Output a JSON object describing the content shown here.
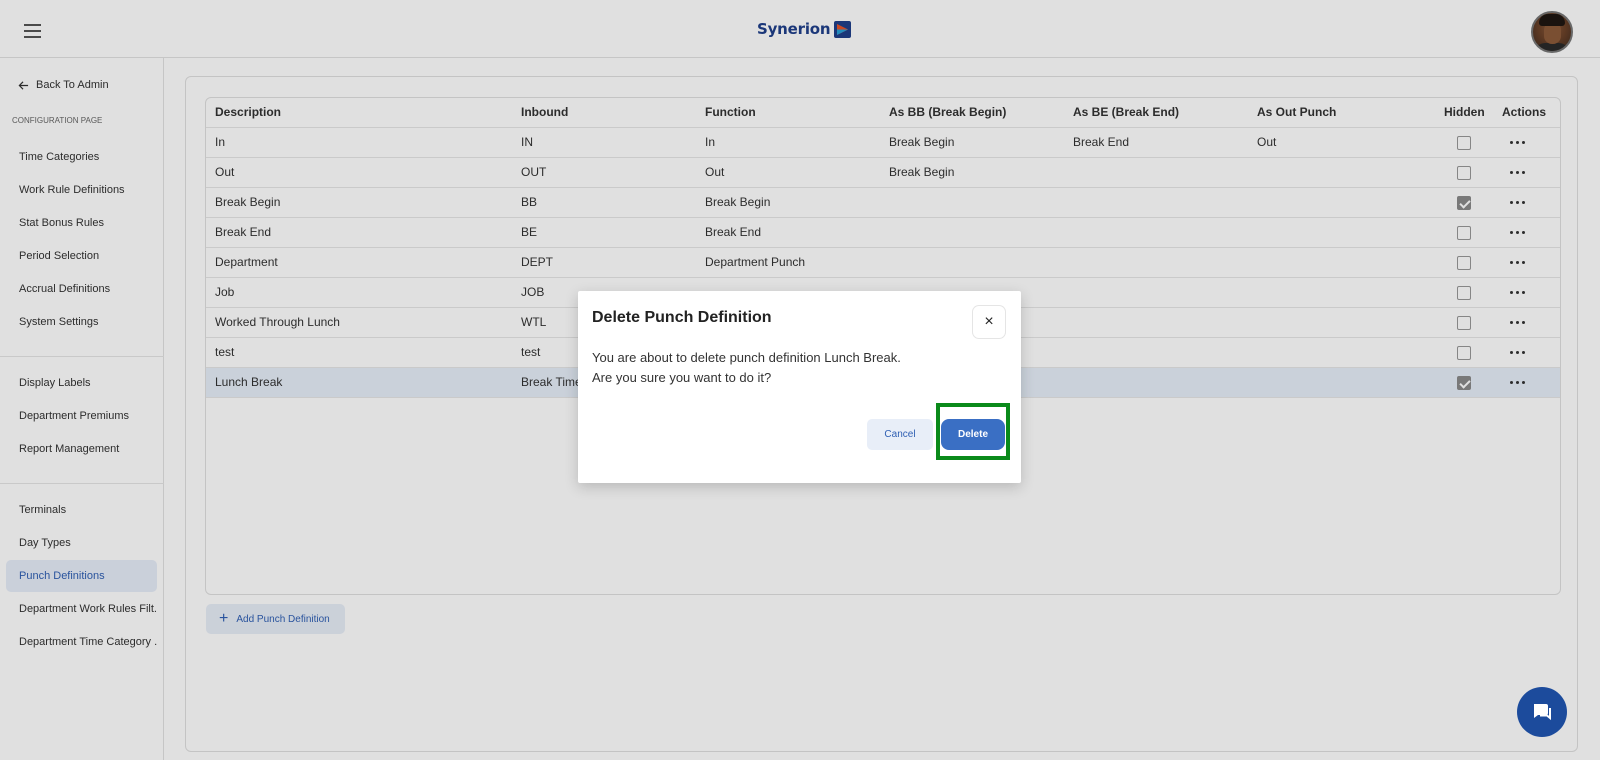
{
  "header": {
    "logo_text": "Synerion",
    "menu_icon": "hamburger-icon",
    "avatar": "user-avatar"
  },
  "sidebar": {
    "back_label": "Back To Admin",
    "section_label": "CONFIGURATION PAGE",
    "groups": [
      [
        "Time Categories",
        "Work Rule Definitions",
        "Stat Bonus Rules",
        "Period Selection",
        "Accrual Definitions",
        "System Settings"
      ],
      [
        "Display Labels",
        "Department Premiums",
        "Report Management"
      ],
      [
        "Terminals",
        "Day Types",
        "Punch Definitions",
        "Department Work Rules Filt...",
        "Department Time Category ..."
      ]
    ],
    "active_item": "Punch Definitions"
  },
  "table": {
    "columns": [
      "Description",
      "Inbound",
      "Function",
      "As BB (Break Begin)",
      "As BE (Break End)",
      "As Out Punch",
      "Hidden",
      "Actions"
    ],
    "rows": [
      {
        "description": "In",
        "inbound": "IN",
        "function": "In",
        "as_bb": "Break Begin",
        "as_be": "Break End",
        "as_out": "Out",
        "hidden": false
      },
      {
        "description": "Out",
        "inbound": "OUT",
        "function": "Out",
        "as_bb": "Break Begin",
        "as_be": "",
        "as_out": "",
        "hidden": false
      },
      {
        "description": "Break Begin",
        "inbound": "BB",
        "function": "Break Begin",
        "as_bb": "",
        "as_be": "",
        "as_out": "",
        "hidden": true
      },
      {
        "description": "Break End",
        "inbound": "BE",
        "function": "Break End",
        "as_bb": "",
        "as_be": "",
        "as_out": "",
        "hidden": false
      },
      {
        "description": "Department",
        "inbound": "DEPT",
        "function": "Department Punch",
        "as_bb": "",
        "as_be": "",
        "as_out": "",
        "hidden": false
      },
      {
        "description": "Job",
        "inbound": "JOB",
        "function": "",
        "as_bb": "",
        "as_be": "",
        "as_out": "",
        "hidden": false
      },
      {
        "description": "Worked Through Lunch",
        "inbound": "WTL",
        "function": "",
        "as_bb": "",
        "as_be": "",
        "as_out": "",
        "hidden": false
      },
      {
        "description": "test",
        "inbound": "test",
        "function": "",
        "as_bb": "",
        "as_be": "",
        "as_out": "",
        "hidden": false
      },
      {
        "description": "Lunch Break",
        "inbound": "Break Time",
        "function": "",
        "as_bb": "",
        "as_be": "",
        "as_out": "",
        "hidden": true,
        "selected": true
      }
    ],
    "add_button_label": "Add Punch Definition"
  },
  "modal": {
    "title": "Delete Punch Definition",
    "message_line1": "You are about to delete punch definition Lunch Break.",
    "message_line2": "Are you sure you want to do it?",
    "close_symbol": "×",
    "cancel_label": "Cancel",
    "delete_label": "Delete"
  },
  "colors": {
    "primary": "#3a6fc4",
    "brand": "#1f3f8a",
    "highlight": "#0a8a1a",
    "chat": "#1c4b9c"
  }
}
